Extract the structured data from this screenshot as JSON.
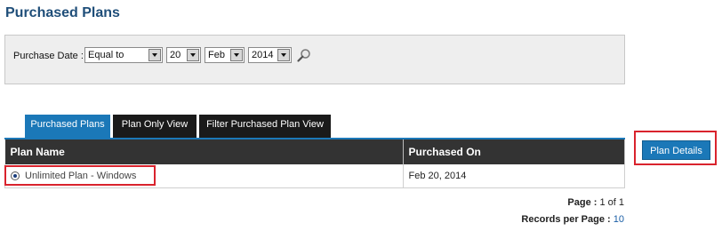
{
  "page": {
    "title": "Purchased Plans"
  },
  "filter": {
    "label": "Purchase Date :",
    "operator": "Equal to",
    "day": "20",
    "month": "Feb",
    "year": "2014"
  },
  "tabs": [
    {
      "label": "Purchased Plans",
      "active": true
    },
    {
      "label": "Plan Only View",
      "active": false
    },
    {
      "label": "Filter Purchased Plan View",
      "active": false
    }
  ],
  "grid": {
    "columns": [
      "Plan Name",
      "Purchased On"
    ],
    "rows": [
      {
        "plan_name": "Unlimited Plan - Windows",
        "purchased_on": "Feb 20, 2014",
        "selected": true
      }
    ]
  },
  "pagination": {
    "page_label": "Page :",
    "page_value": "1 of 1",
    "records_label": "Records per Page :",
    "records_value": "10"
  },
  "actions": {
    "plan_details_label": "Plan Details"
  },
  "colors": {
    "accent": "#1b78b8",
    "highlight": "#d9232d",
    "header": "#333333"
  }
}
